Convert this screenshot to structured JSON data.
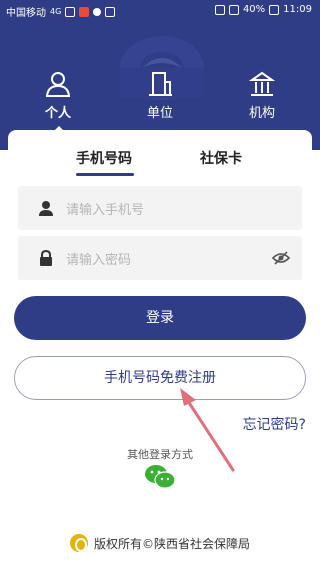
{
  "status_bar": {
    "carrier": "中国移动",
    "network": "4G",
    "battery": "40%",
    "time": "11:09"
  },
  "role_tabs": [
    {
      "label": "个人",
      "icon": "person-icon",
      "active": true
    },
    {
      "label": "单位",
      "icon": "building-icon",
      "active": false
    },
    {
      "label": "机构",
      "icon": "institution-icon",
      "active": false
    }
  ],
  "login_tabs": [
    {
      "label": "手机号码",
      "active": true
    },
    {
      "label": "社保卡",
      "active": false
    }
  ],
  "fields": {
    "phone_placeholder": "请输入手机号",
    "password_placeholder": "请输入密码"
  },
  "buttons": {
    "login": "登录",
    "register": "手机号码免费注册",
    "forgot": "忘记密码?"
  },
  "other_login": {
    "label": "其他登录方式",
    "method_icon": "wechat-icon"
  },
  "footer": {
    "copyright": "版权所有©陕西省社会保障局"
  },
  "colors": {
    "brand": "#2f3d86",
    "annotation_arrow": "#e0707a"
  }
}
